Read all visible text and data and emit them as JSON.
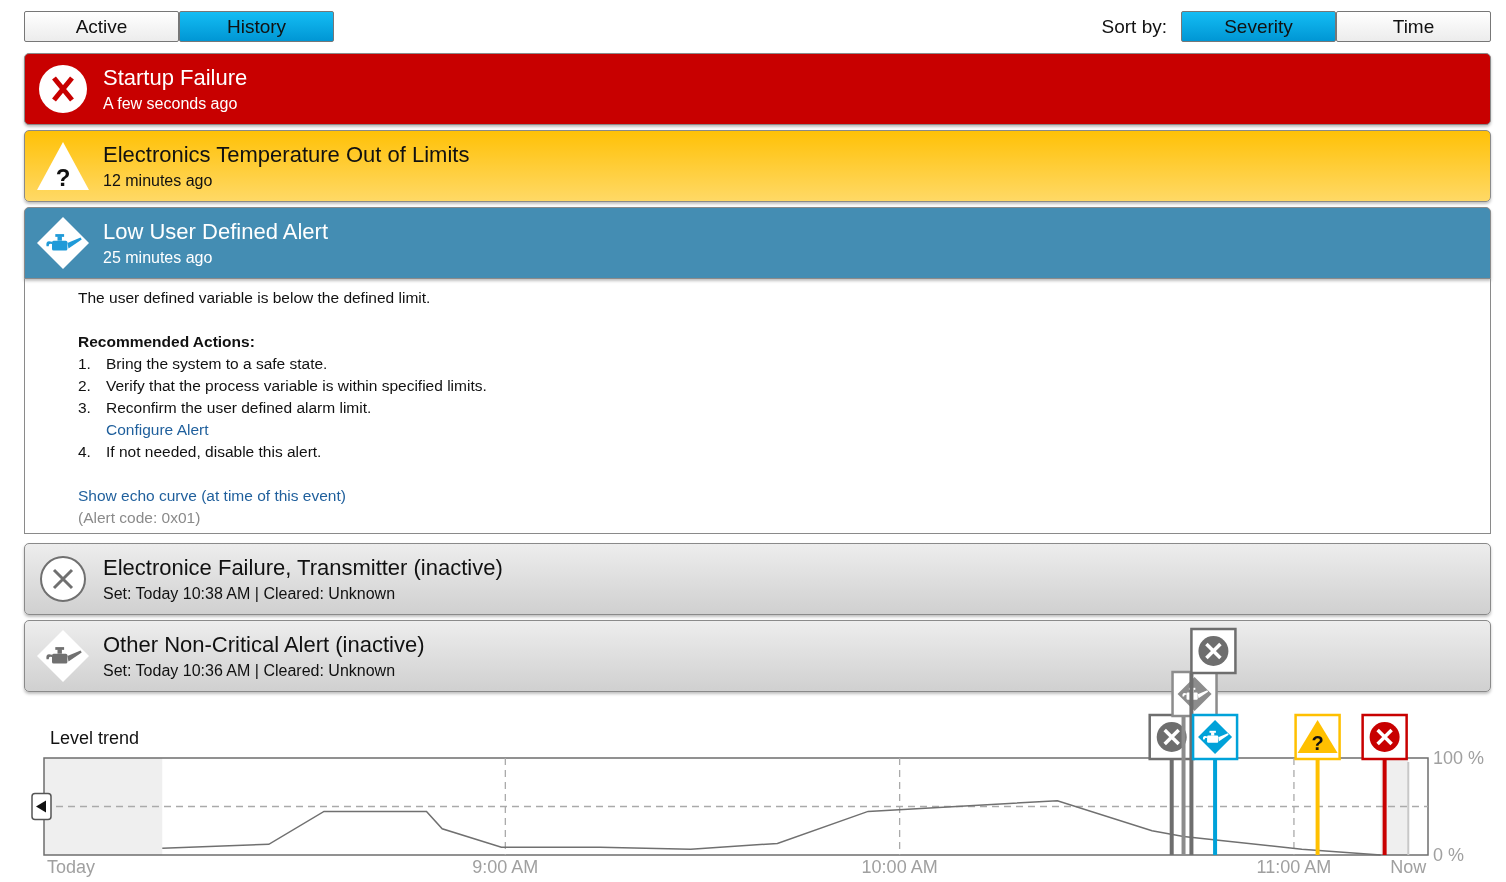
{
  "view_tabs": [
    {
      "label": "Active",
      "selected": false
    },
    {
      "label": "History",
      "selected": true
    }
  ],
  "sort": {
    "label": "Sort by:",
    "options": [
      {
        "label": "Severity",
        "selected": true
      },
      {
        "label": "Time",
        "selected": false
      }
    ]
  },
  "alerts": [
    {
      "kind": "failure",
      "active": true,
      "expanded": false,
      "title": "Startup Failure",
      "subtitle": "A few seconds ago"
    },
    {
      "kind": "warning",
      "active": true,
      "expanded": false,
      "symbol": "?",
      "title": "Electronics Temperature Out of Limits",
      "subtitle": "12 minutes ago"
    },
    {
      "kind": "maintenance",
      "active": true,
      "expanded": true,
      "title": "Low User Defined Alert",
      "subtitle": "25 minutes ago",
      "details": {
        "description": "The user defined variable is below the defined limit.",
        "actions_heading": "Recommended Actions:",
        "actions": [
          {
            "number": "1.",
            "text": "Bring the system to a safe state."
          },
          {
            "number": "2.",
            "text": "Verify that the process variable is within specified limits."
          },
          {
            "number": "3.",
            "text": "Reconfirm the user defined alarm limit.",
            "link": "Configure Alert"
          },
          {
            "number": "4.",
            "text": "If not needed, disable this alert."
          }
        ],
        "echo_link": "Show echo curve (at time of this event)",
        "code": "(Alert code: 0x01)"
      }
    },
    {
      "kind": "failure",
      "active": false,
      "expanded": false,
      "title": "Electronice Failure, Transmitter (inactive)",
      "subtitle": "Set: Today 10:38 AM | Cleared: Unknown"
    },
    {
      "kind": "maintenance",
      "active": false,
      "expanded": false,
      "title": "Other Non-Critical Alert (inactive)",
      "subtitle": "Set: Today 10:36 AM | Cleared: Unknown"
    }
  ],
  "trend": {
    "chart_data": {
      "type": "line",
      "title": "Level trend",
      "x": [
        8.13,
        8.4,
        8.54,
        8.8,
        8.84,
        8.99,
        9.24,
        9.47,
        9.69,
        9.92,
        10.4,
        10.64,
        10.72,
        11.02,
        11.22
      ],
      "series": [
        {
          "color": "#707070",
          "values": [
            7,
            11,
            45,
            45,
            27,
            8,
            8,
            6,
            12,
            45,
            56,
            25,
            19,
            6,
            0
          ]
        }
      ],
      "xlim": [
        7.83,
        11.34
      ],
      "ylim": [
        0,
        100
      ],
      "xticks": [
        {
          "value": 7.83,
          "label": "Today"
        },
        {
          "value": 9,
          "label": "9:00 AM"
        },
        {
          "value": 10,
          "label": "10:00 AM"
        },
        {
          "value": 11,
          "label": "11:00 AM"
        },
        {
          "value": 11.29,
          "label": "Now"
        }
      ],
      "yticks": [
        {
          "value": 0,
          "label": "0 %"
        },
        {
          "value": 100,
          "label": "100 %"
        }
      ],
      "grid": true,
      "bands": [
        {
          "axis": "x",
          "from": 7.83,
          "to": 8.13
        },
        {
          "axis": "x",
          "from": 11.22,
          "to": 11.29
        }
      ],
      "ref_lines": [
        {
          "axis": "x",
          "value": 11.29
        }
      ]
    },
    "markers": [
      {
        "kind": "failure",
        "color": "#6e6e6e"
      },
      {
        "kind": "maintenance",
        "color": "#8c8c8c"
      },
      {
        "kind": "failure",
        "color": "#6e6e6e"
      },
      {
        "kind": "maintenance",
        "color": "#00a2d9"
      },
      {
        "kind": "warning",
        "color": "#ffc000",
        "symbol": "?"
      },
      {
        "kind": "failure",
        "color": "#c80000"
      }
    ]
  }
}
